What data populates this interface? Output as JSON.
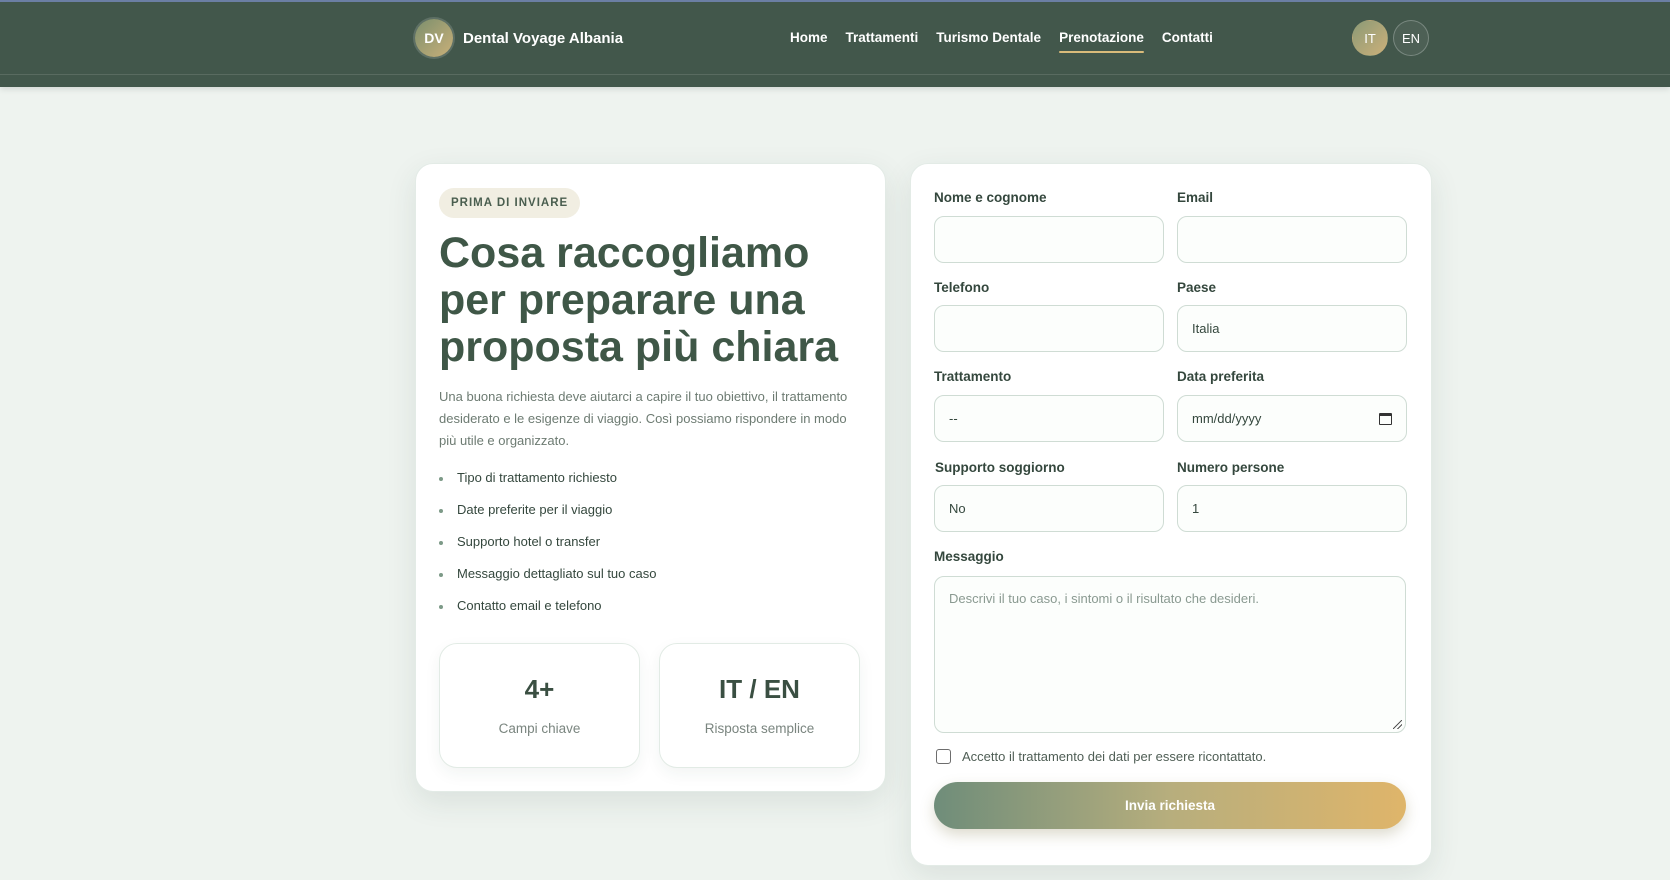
{
  "header": {
    "logo_initials": "DV",
    "brand_name": "Dental Voyage Albania",
    "nav": [
      {
        "label": "Home",
        "active": false
      },
      {
        "label": "Trattamenti",
        "active": false
      },
      {
        "label": "Turismo Dentale",
        "active": false
      },
      {
        "label": "Prenotazione",
        "active": true
      },
      {
        "label": "Contatti",
        "active": false
      }
    ],
    "languages": [
      {
        "label": "IT",
        "active": true
      },
      {
        "label": "EN",
        "active": false
      }
    ]
  },
  "info": {
    "badge": "PRIMA DI INVIARE",
    "headline": "Cosa raccogliamo per preparare una proposta più chiara",
    "intro": "Una buona richiesta deve aiutarci a capire il tuo obiettivo, il trattamento desiderato e le esigenze di viaggio. Così possiamo rispondere in modo più utile e organizzato.",
    "features": [
      "Tipo di trattamento richiesto",
      "Date preferite per il viaggio",
      "Supporto hotel o transfer",
      "Messaggio dettagliato sul tuo caso",
      "Contatto email e telefono"
    ],
    "stats": [
      {
        "value": "4+",
        "label": "Campi chiave"
      },
      {
        "value": "IT / EN",
        "label": "Risposta semplice"
      }
    ]
  },
  "form": {
    "name_label": "Nome e cognome",
    "name_value": "",
    "email_label": "Email",
    "email_value": "",
    "phone_label": "Telefono",
    "phone_value": "",
    "country_label": "Paese",
    "country_value": "Italia",
    "treatment_label": "Trattamento",
    "treatment_value": "--",
    "date_label": "Data preferita",
    "date_value": "mm/dd/yyyy",
    "stay_label": "Supporto soggiorno",
    "stay_value": "No",
    "people_label": "Numero persone",
    "people_value": "1",
    "message_label": "Messaggio",
    "message_placeholder": "Descrivi il tuo caso, i sintomi o il risultato che desideri.",
    "consent_text": "Accetto il trattamento dei dati per essere ricontattato.",
    "submit_label": "Invia richiesta"
  }
}
